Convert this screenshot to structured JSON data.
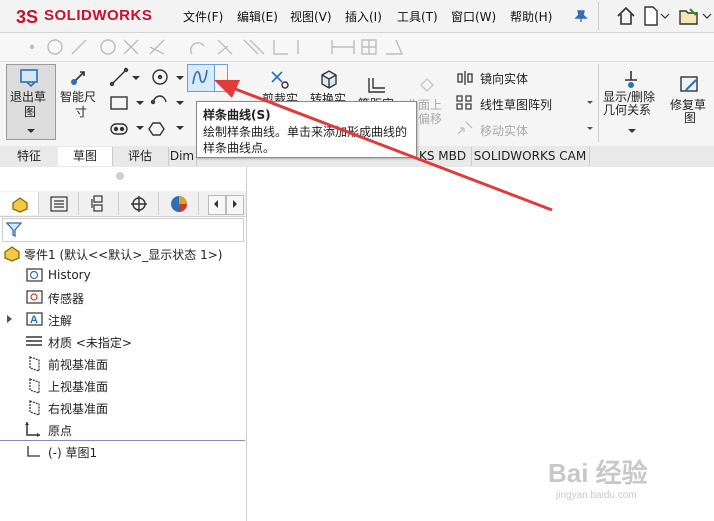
{
  "app": {
    "name": "SOLIDWORKS"
  },
  "menu": [
    "文件(F)",
    "编辑(E)",
    "视图(V)",
    "插入(I)",
    "工具(T)",
    "窗口(W)",
    "帮助(H)"
  ],
  "ribbon": {
    "exit_sketch": [
      "退出草",
      "图"
    ],
    "smart_dim": [
      "智能尺",
      "寸"
    ],
    "trim": "剪裁实",
    "convert": "转换实",
    "offset": "等距实",
    "offset_surface": [
      "曲面上",
      "偏移"
    ],
    "mirror": "镜向实体",
    "linear_pattern": "线性草图阵列",
    "move": "移动实体",
    "show_delete": [
      "显示/删除",
      "几何关系"
    ],
    "repair": [
      "修复草",
      "图"
    ]
  },
  "tabs": [
    "特征",
    "草图",
    "评估",
    "Dim",
    "KS MBD",
    "SOLIDWORKS CAM"
  ],
  "tooltip": {
    "title": "样条曲线(S)",
    "desc": "绘制样条曲线。单击来添加形成曲线的样条曲线点。"
  },
  "tree": {
    "root": "零件1 (默认<<默认>_显示状态 1>)",
    "items": [
      "History",
      "传感器",
      "注解",
      "材质 <未指定>",
      "前视基准面",
      "上视基准面",
      "右视基准面",
      "原点",
      "(-) 草图1"
    ]
  },
  "watermark": {
    "text": "Bai 经验",
    "url": "jingyan.baidu.com"
  },
  "colors": {
    "brand": "#c8102e",
    "arrow": "#e03a3a",
    "accent": "#2f6fb5"
  }
}
